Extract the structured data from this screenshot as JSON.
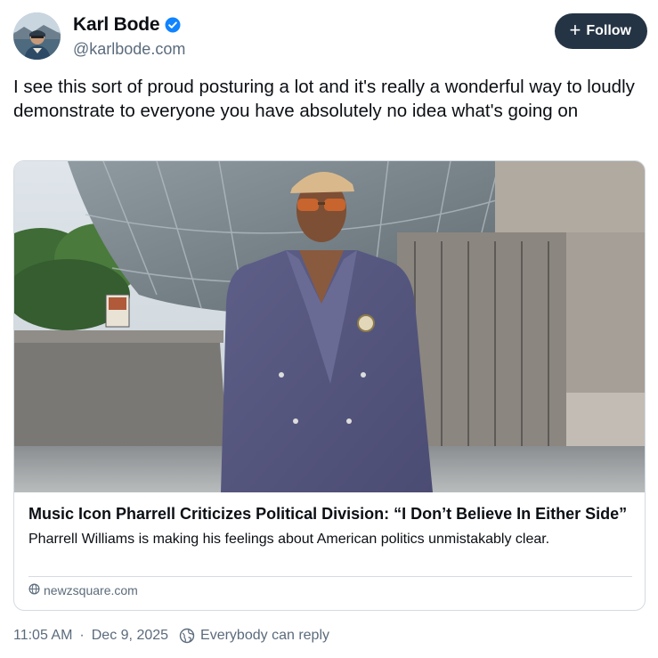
{
  "author": {
    "display_name": "Karl Bode",
    "handle": "@karlbode.com",
    "verified": true,
    "avatar_icon": "person-avatar"
  },
  "follow_button": {
    "icon": "plus-icon",
    "label": "Follow"
  },
  "post": {
    "text": "I see this sort of proud posturing a lot and it's really a wonderful way to loudly demonstrate to everyone you have absolutely no idea what's going on"
  },
  "link_card": {
    "title": "Music Icon Pharrell Criticizes Political Division: “I Don’t Believe In Either Side”",
    "description": "Pharrell Williams is making his feelings about American politics unmistakably clear.",
    "source": "newzsquare.com",
    "source_icon": "globe-icon"
  },
  "meta": {
    "time": "11:05 AM",
    "separator": "·",
    "date": "Dec 9, 2025",
    "reply_setting_icon": "globe-reply-icon",
    "reply_setting": "Everybody can reply"
  },
  "colors": {
    "follow_bg": "#253445",
    "verified_blue": "#1083fe",
    "muted_text": "#5b6b7c",
    "border": "#d4dbe2"
  }
}
